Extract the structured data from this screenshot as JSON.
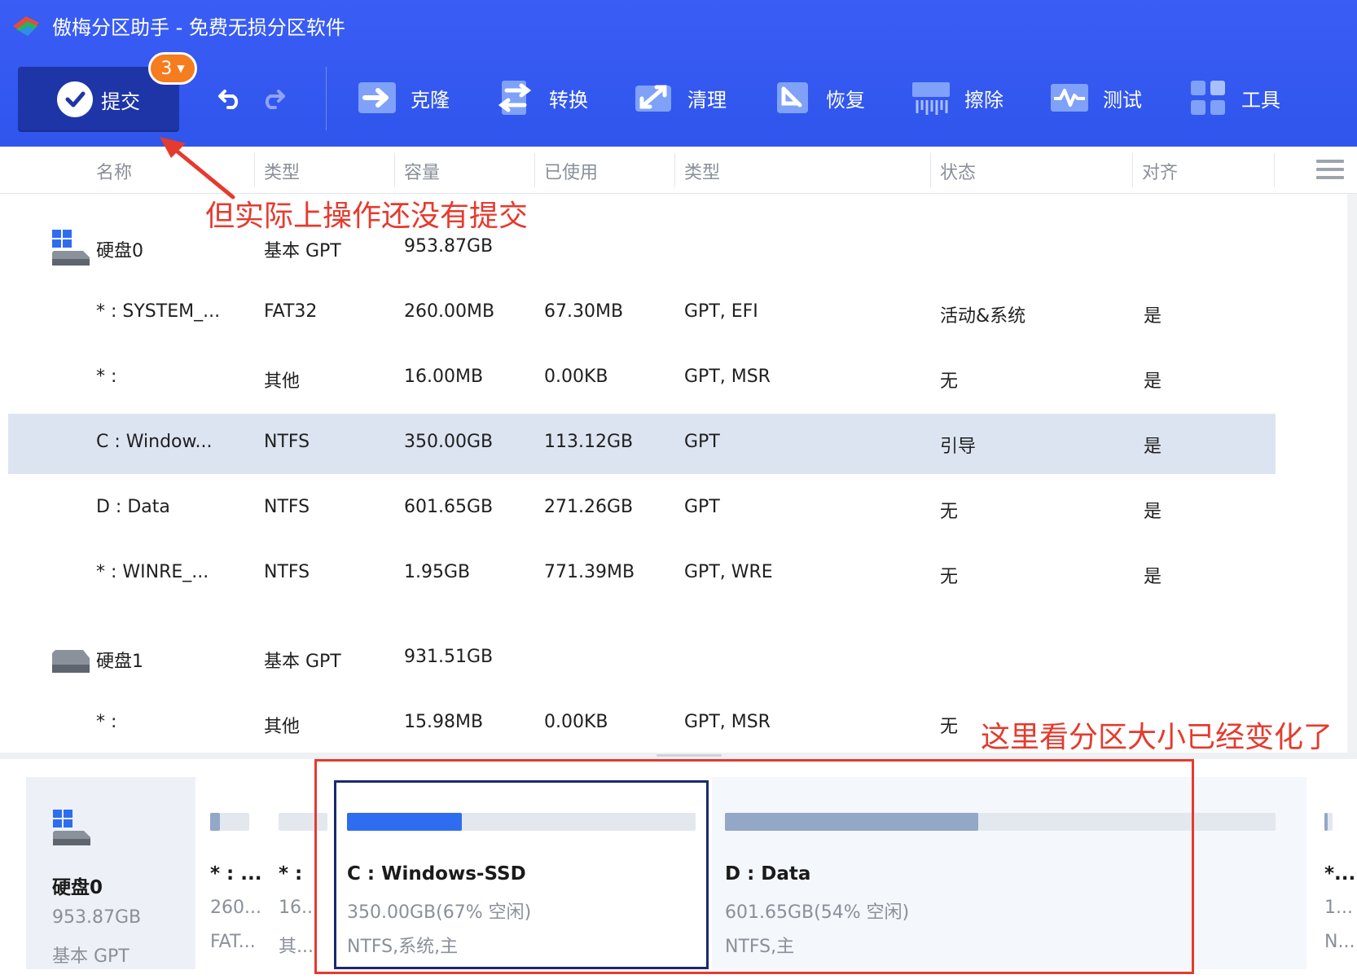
{
  "app": {
    "title": "傲梅分区助手 - 免费无损分区软件"
  },
  "toolbar": {
    "commit_label": "提交",
    "pending_count": "3",
    "tools": [
      {
        "id": "clone",
        "label": "克隆",
        "icon": "clone-icon"
      },
      {
        "id": "convert",
        "label": "转换",
        "icon": "convert-icon"
      },
      {
        "id": "clean",
        "label": "清理",
        "icon": "clean-icon"
      },
      {
        "id": "recover",
        "label": "恢复",
        "icon": "recover-icon"
      },
      {
        "id": "wipe",
        "label": "擦除",
        "icon": "wipe-icon"
      },
      {
        "id": "test",
        "label": "测试",
        "icon": "test-icon"
      },
      {
        "id": "tools",
        "label": "工具",
        "icon": "tools-icon"
      }
    ]
  },
  "table": {
    "columns": [
      "名称",
      "类型",
      "容量",
      "已使用",
      "类型",
      "状态",
      "对齐"
    ],
    "rows": [
      {
        "kind": "disk",
        "name": "硬盘0",
        "type": "基本 GPT",
        "capacity": "953.87GB"
      },
      {
        "kind": "partition",
        "name": "* : SYSTEM_...",
        "type": "FAT32",
        "capacity": "260.00MB",
        "used": "67.30MB",
        "ptype": "GPT, EFI",
        "status": "活动&系统",
        "align": "是"
      },
      {
        "kind": "partition",
        "name": "* :",
        "type": "其他",
        "capacity": "16.00MB",
        "used": "0.00KB",
        "ptype": "GPT, MSR",
        "status": "无",
        "align": "是"
      },
      {
        "kind": "partition",
        "name": "C : Window...",
        "type": "NTFS",
        "capacity": "350.00GB",
        "used": "113.12GB",
        "ptype": "GPT",
        "status": "引导",
        "align": "是",
        "selected": true
      },
      {
        "kind": "partition",
        "name": "D : Data",
        "type": "NTFS",
        "capacity": "601.65GB",
        "used": "271.26GB",
        "ptype": "GPT",
        "status": "无",
        "align": "是"
      },
      {
        "kind": "partition",
        "name": "* : WINRE_...",
        "type": "NTFS",
        "capacity": "1.95GB",
        "used": "771.39MB",
        "ptype": "GPT, WRE",
        "status": "无",
        "align": "是"
      },
      {
        "kind": "disk",
        "name": "硬盘1",
        "type": "基本 GPT",
        "capacity": "931.51GB"
      },
      {
        "kind": "partition",
        "name": "* :",
        "type": "其他",
        "capacity": "15.98MB",
        "used": "0.00KB",
        "ptype": "GPT, MSR",
        "status": "无",
        "align": ""
      }
    ]
  },
  "annotations": {
    "commit_note": "但实际上操作还没有提交",
    "size_note": "这里看分区大小已经变化了"
  },
  "disk_map": {
    "disk": {
      "name": "硬盘0",
      "size": "953.87GB",
      "type": "基本 GPT"
    },
    "partitions": [
      {
        "name": "* : ...",
        "info1": "260...",
        "info2": "FAT...",
        "used_fraction": 0.26
      },
      {
        "name": "* :",
        "info1": "16...",
        "info2": "其...",
        "used_fraction": 0
      },
      {
        "name": "C : Windows-SSD",
        "info1": "350.00GB(67% 空闲)",
        "info2": "NTFS,系统,主",
        "used_fraction": 0.33
      },
      {
        "name": "D : Data",
        "info1": "601.65GB(54% 空闲)",
        "info2": "NTFS,主",
        "used_fraction": 0.46
      },
      {
        "name": "*...",
        "info1": "1...",
        "info2": "N...",
        "used_fraction": 0.4
      }
    ]
  },
  "colors": {
    "topbar": "#2f55ec",
    "commit": "#1e35a8",
    "badge": "#f57c1f",
    "selected_row": "#dde4f1",
    "annotation": "#e53a2e",
    "bar_c": "#2f6df0",
    "bar_d": "#93a7c6"
  }
}
